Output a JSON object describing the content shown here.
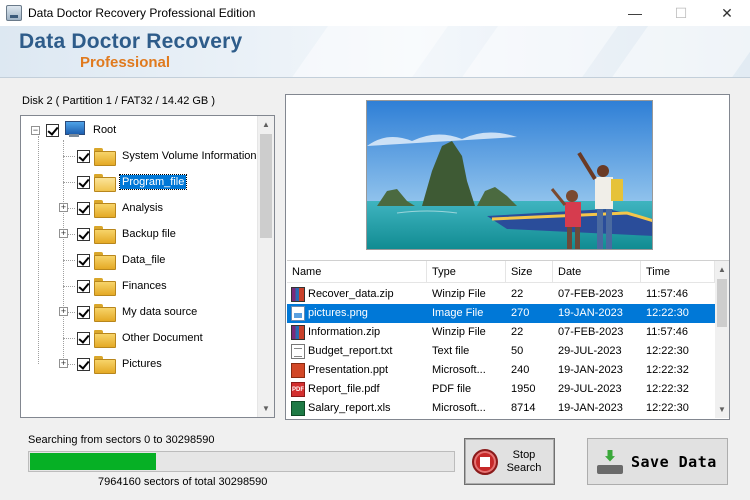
{
  "window": {
    "title": "Data Doctor Recovery Professional Edition",
    "minimize_icon": "—",
    "maximize_icon": "☐",
    "close_icon": "✕"
  },
  "banner": {
    "title": "Data Doctor Recovery",
    "subtitle": "Professional"
  },
  "disk_label": "Disk 2 ( Partition 1 / FAT32 / 14.42 GB )",
  "tree": {
    "root": {
      "label": "Root",
      "checked": true,
      "expander": "−"
    },
    "items": [
      {
        "label": "System Volume Information",
        "checked": true,
        "expander": "",
        "selected": false
      },
      {
        "label": "Program_file",
        "checked": true,
        "expander": "",
        "selected": true
      },
      {
        "label": "Analysis",
        "checked": true,
        "expander": "+",
        "selected": false
      },
      {
        "label": "Backup file",
        "checked": true,
        "expander": "+",
        "selected": false
      },
      {
        "label": "Data_file",
        "checked": true,
        "expander": "",
        "selected": false
      },
      {
        "label": "Finances",
        "checked": true,
        "expander": "",
        "selected": false
      },
      {
        "label": "My data source",
        "checked": true,
        "expander": "+",
        "selected": false
      },
      {
        "label": "Other Document",
        "checked": true,
        "expander": "",
        "selected": false
      },
      {
        "label": "Pictures",
        "checked": true,
        "expander": "+",
        "selected": false
      }
    ]
  },
  "file_list": {
    "columns": [
      "Name",
      "Type",
      "Size",
      "Date",
      "Time"
    ],
    "rows": [
      {
        "icon": "zip",
        "name": "Recover_data.zip",
        "type": "Winzip File",
        "size": "22",
        "date": "07-FEB-2023",
        "time": "11:57:46",
        "selected": false
      },
      {
        "icon": "png",
        "name": "pictures.png",
        "type": "Image File",
        "size": "270",
        "date": "19-JAN-2023",
        "time": "12:22:30",
        "selected": true
      },
      {
        "icon": "zip",
        "name": "Information.zip",
        "type": "Winzip File",
        "size": "22",
        "date": "07-FEB-2023",
        "time": "11:57:46",
        "selected": false
      },
      {
        "icon": "txt",
        "name": "Budget_report.txt",
        "type": "Text file",
        "size": "50",
        "date": "29-JUL-2023",
        "time": "12:22:30",
        "selected": false
      },
      {
        "icon": "ppt",
        "name": "Presentation.ppt",
        "type": "Microsoft...",
        "size": "240",
        "date": "19-JAN-2023",
        "time": "12:22:32",
        "selected": false
      },
      {
        "icon": "pdf",
        "name": "Report_file.pdf",
        "type": "PDF file",
        "size": "1950",
        "date": "29-JUL-2023",
        "time": "12:22:32",
        "selected": false
      },
      {
        "icon": "xls",
        "name": "Salary_report.xls",
        "type": "Microsoft...",
        "size": "8714",
        "date": "19-JAN-2023",
        "time": "12:22:30",
        "selected": false
      }
    ]
  },
  "pdf_icon_text": "PDF",
  "search_status": "Searching from sectors    0 to 30298590",
  "progress": {
    "fraction": 0.296
  },
  "sectors_status": "7964160   sectors  of  total 30298590",
  "stop_button": {
    "label": "Stop Search"
  },
  "save_button": {
    "label": "Save Data"
  },
  "colors": {
    "accent": "#0078d7",
    "progress": "#06b025",
    "banner_title": "#2e5c8a",
    "banner_sub": "#e07a1e"
  }
}
